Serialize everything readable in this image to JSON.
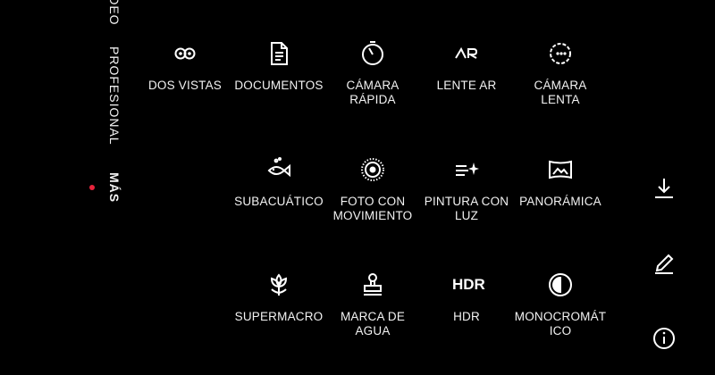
{
  "modes": {
    "video": "VÍDEO",
    "professional": "PROFESIONAL",
    "more": "MÁS"
  },
  "active_mode_color": "#e8243c",
  "tiles": [
    {
      "icon": "dual-view-icon",
      "label_1": "DOS VISTAS",
      "label_2": ""
    },
    {
      "icon": "document-icon",
      "label_1": "DOCUMENTOS",
      "label_2": ""
    },
    {
      "icon": "timer-icon",
      "label_1": "CÁMARA",
      "label_2": "RÁPIDA"
    },
    {
      "icon": "ar-lens-icon",
      "label_1": "LENTE AR",
      "label_2": ""
    },
    {
      "icon": "slow-motion-icon",
      "label_1": "CÁMARA",
      "label_2": "LENTA"
    },
    {
      "icon": "fish-icon",
      "label_1": "SUBACUÁTICO",
      "label_2": ""
    },
    {
      "icon": "moving-photo-icon",
      "label_1": "FOTO CON",
      "label_2": "MOVIMIENTO"
    },
    {
      "icon": "light-painting-icon",
      "label_1": "PINTURA CON",
      "label_2": "LUZ"
    },
    {
      "icon": "panorama-icon",
      "label_1": "PANORÁMICA",
      "label_2": ""
    },
    {
      "icon": "flower-icon",
      "label_1": "SUPERMACRO",
      "label_2": ""
    },
    {
      "icon": "stamp-icon",
      "label_1": "MARCA DE",
      "label_2": "AGUA"
    },
    {
      "icon": "hdr-icon",
      "icon_text": "HDR",
      "label_1": "HDR",
      "label_2": ""
    },
    {
      "icon": "monochrome-icon",
      "label_1": "MONOCROMÁT",
      "label_2": "ICO"
    }
  ],
  "side_buttons": [
    "download-icon",
    "edit-icon",
    "info-icon"
  ]
}
